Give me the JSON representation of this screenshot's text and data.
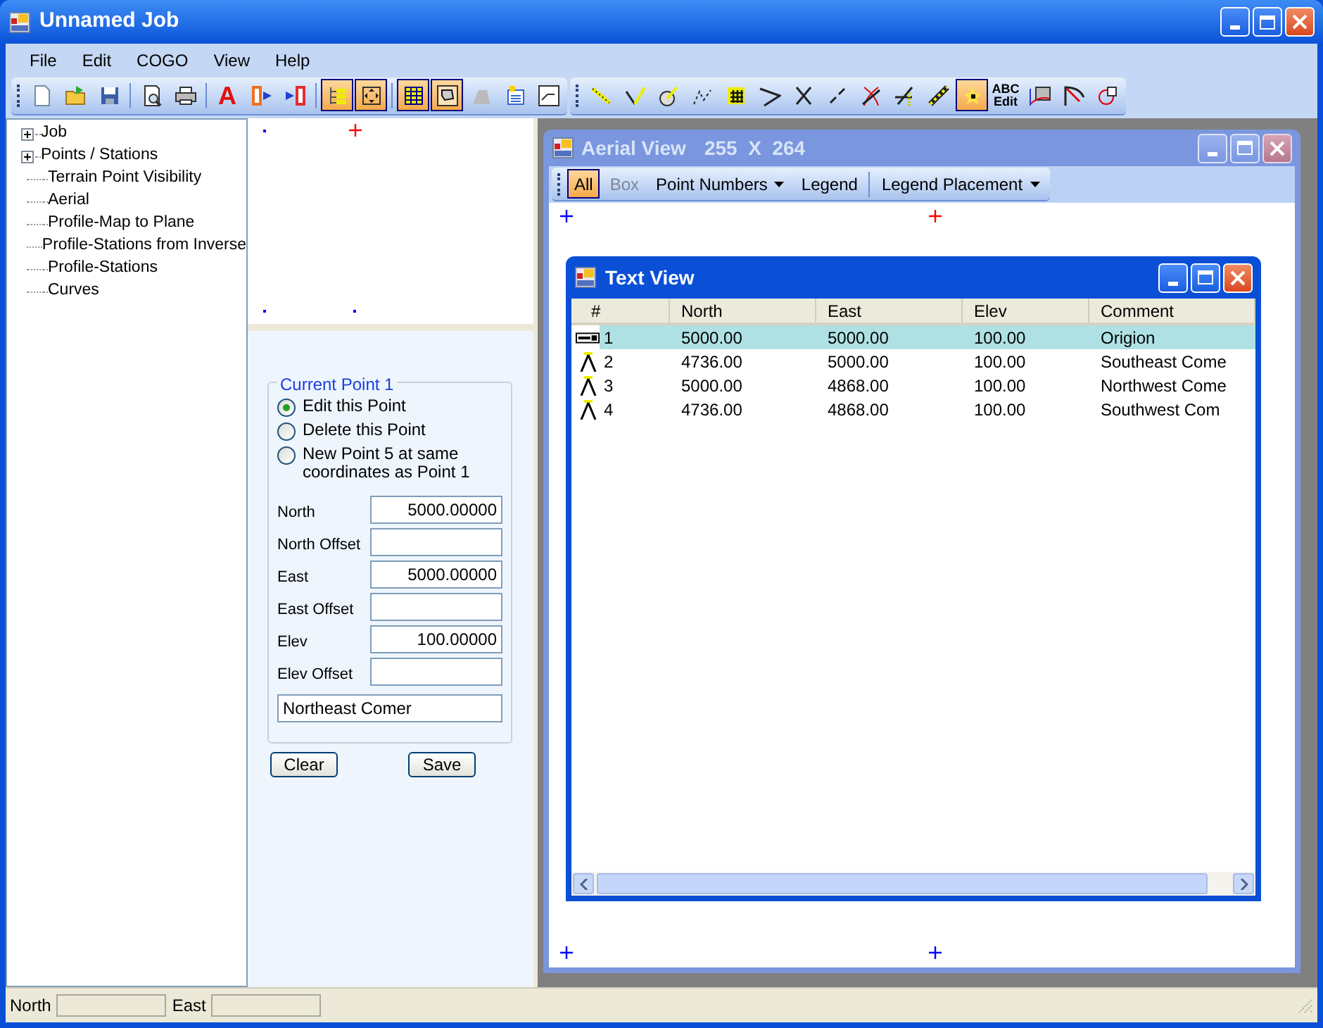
{
  "window": {
    "title": "Unnamed Job"
  },
  "menu": [
    "File",
    "Edit",
    "COGO",
    "View",
    "Help"
  ],
  "toolbars": [
    {
      "groups": [
        [
          {
            "kind": "new",
            "selected": false
          },
          {
            "kind": "open",
            "selected": false
          },
          {
            "kind": "save",
            "selected": false
          }
        ],
        [
          {
            "kind": "preview",
            "selected": false
          },
          {
            "kind": "print",
            "selected": false
          }
        ],
        [
          {
            "kind": "letter",
            "label": "A",
            "selected": false
          },
          {
            "kind": "export",
            "selected": false
          },
          {
            "kind": "import",
            "selected": false
          }
        ],
        [
          {
            "kind": "tree",
            "selected": true
          },
          {
            "kind": "fit",
            "selected": true
          }
        ],
        [
          {
            "kind": "table",
            "selected": true
          },
          {
            "kind": "map",
            "selected": true
          },
          {
            "kind": "grey-shape",
            "selected": false
          },
          {
            "kind": "doc-window",
            "selected": false
          },
          {
            "kind": "split-window",
            "selected": false
          }
        ]
      ]
    },
    {
      "groups": [
        [
          {
            "kind": "diag-line",
            "selected": false
          },
          {
            "kind": "angle",
            "selected": false
          },
          {
            "kind": "circle-line",
            "selected": false
          },
          {
            "kind": "traverse",
            "selected": false
          },
          {
            "kind": "grid",
            "selected": false
          },
          {
            "kind": "chevron",
            "selected": false
          },
          {
            "kind": "cross",
            "selected": false
          },
          {
            "kind": "dashed",
            "selected": false
          },
          {
            "kind": "curve-cross",
            "selected": false
          },
          {
            "kind": "intersect",
            "selected": false
          },
          {
            "kind": "ruler",
            "selected": false
          },
          {
            "kind": "point",
            "selected": true
          },
          {
            "kind": "text",
            "label": "ABC",
            "sublabel": "Edit",
            "selected": false
          },
          {
            "kind": "map-curve",
            "selected": false
          },
          {
            "kind": "arc",
            "selected": false
          },
          {
            "kind": "circle-square",
            "selected": false
          }
        ]
      ]
    }
  ],
  "tree": {
    "items": [
      {
        "label": "Job",
        "expanded": false
      },
      {
        "label": "Points / Stations",
        "expanded": false
      },
      {
        "label": "Terrain Point Visibility"
      },
      {
        "label": "Aerial"
      },
      {
        "label": "Profile-Map to Plane"
      },
      {
        "label": "Profile-Stations from Inverse"
      },
      {
        "label": "Profile-Stations"
      },
      {
        "label": "Curves"
      }
    ]
  },
  "current_point": {
    "title": "Current Point 1",
    "options": [
      {
        "label": "Edit this Point",
        "selected": true
      },
      {
        "label": "Delete this Point",
        "selected": false
      },
      {
        "label": "New Point 5 at same coordinates as Point 1",
        "selected": false
      }
    ],
    "fields": [
      {
        "label": "North",
        "value": "5000.00000"
      },
      {
        "label": "North Offset"
      },
      {
        "label": "East",
        "value": "5000.00000"
      },
      {
        "label": "East Offset"
      },
      {
        "label": "Elev",
        "value": "100.00000"
      },
      {
        "label": "Elev Offset"
      }
    ],
    "comment": {
      "value": "Northeast Comer"
    }
  },
  "buttons": [
    "Clear",
    "Save"
  ],
  "aerial_view": {
    "title": "Aerial View",
    "size": "255  X  264",
    "toolbar_groups": [
      [
        {
          "kind": "button",
          "label": "All",
          "selected": true,
          "disabled": false
        },
        {
          "kind": "button",
          "label": "Box",
          "selected": false,
          "disabled": true
        },
        {
          "kind": "dropdown",
          "label": "Point Numbers",
          "selected": false,
          "disabled": false
        },
        {
          "kind": "button",
          "label": "Legend",
          "selected": false,
          "disabled": false
        }
      ],
      [
        {
          "kind": "dropdown",
          "label": "Legend Placement",
          "selected": false,
          "disabled": false
        }
      ]
    ]
  },
  "text_view": {
    "title": "Text View",
    "columns": [
      "#",
      "North",
      "East",
      "Elev",
      "Comment"
    ],
    "rows": [
      {
        "kind": "benchmark",
        "selected": true,
        "cells": [
          "1",
          "5000.00",
          "5000.00",
          "100.00",
          "Origion"
        ]
      },
      {
        "kind": "tripod",
        "selected": false,
        "cells": [
          "2",
          "4736.00",
          "5000.00",
          "100.00",
          "Southeast Come"
        ]
      },
      {
        "kind": "tripod",
        "selected": false,
        "cells": [
          "3",
          "5000.00",
          "4868.00",
          "100.00",
          "Northwest Come"
        ]
      },
      {
        "kind": "tripod",
        "selected": false,
        "cells": [
          "4",
          "4736.00",
          "4868.00",
          "100.00",
          "Southwest Com"
        ]
      }
    ]
  },
  "status_bar": [
    {
      "label": "North"
    },
    {
      "label": "East"
    }
  ]
}
